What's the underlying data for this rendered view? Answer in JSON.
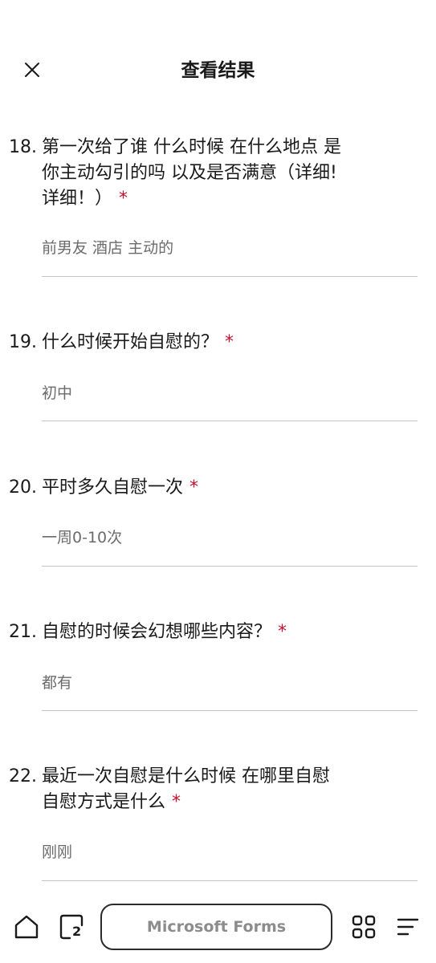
{
  "header": {
    "title": "查看结果",
    "close_icon": "close-icon"
  },
  "questions": [
    {
      "number": "18.",
      "lines": [
        "第一次给了谁 什么时候 在什么地点 是",
        "你主动勾引的吗 以及是否满意（详细!",
        "详细！）"
      ],
      "required_mark": "*",
      "answer": "前男友 酒店 主动的"
    },
    {
      "number": "19.",
      "lines": [
        "什么时候开始自慰的？"
      ],
      "required_mark": "*",
      "answer": "初中"
    },
    {
      "number": "20.",
      "lines": [
        "平时多久自慰一次"
      ],
      "required_mark": "*",
      "answer": "一周0-10次"
    },
    {
      "number": "21.",
      "lines": [
        "自慰的时候会幻想哪些内容？"
      ],
      "required_mark": "*",
      "answer": "都有"
    },
    {
      "number": "22.",
      "lines": [
        "最近一次自慰是什么时候 在哪里自慰",
        "自慰方式是什么"
      ],
      "required_mark": "*",
      "answer": "刚刚"
    }
  ],
  "bottom_bar": {
    "home_icon": "home-icon",
    "tabs_icon": "tabs-icon",
    "tab_count": "2",
    "address_text": "Microsoft Forms",
    "apps_icon": "apps-grid-icon",
    "menu_icon": "menu-icon"
  },
  "colors": {
    "required": "#c8102e",
    "answer_text": "#6b6b6b",
    "divider": "#c4c4c4"
  }
}
